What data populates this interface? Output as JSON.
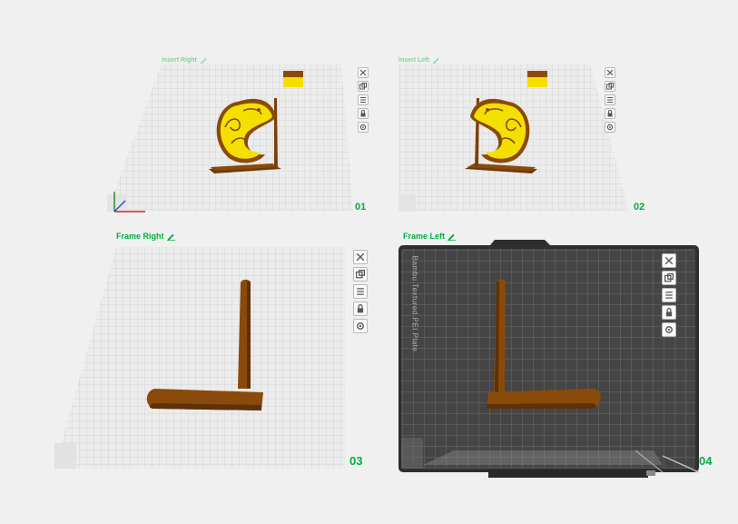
{
  "plates": [
    {
      "id": "plate-01",
      "name": "Insert Right",
      "number": "01"
    },
    {
      "id": "plate-02",
      "name": "Insert Left",
      "number": "02"
    },
    {
      "id": "plate-03",
      "name": "Frame Right",
      "number": "03"
    },
    {
      "id": "plate-04",
      "name": "Frame Left",
      "number": "04"
    }
  ],
  "textured_plate_text": "Bambu Textured PEI Plate",
  "toolbar_icons": [
    "close-icon",
    "arrange-icon",
    "settings-icon",
    "lock-icon",
    "gear-icon"
  ],
  "colors": {
    "accent": "#00ae42",
    "model_brown": "#8a4a0a",
    "model_yellow": "#f4e000",
    "grid_light": "#d8d8d8",
    "plate_dark": "#3a3a3a"
  }
}
